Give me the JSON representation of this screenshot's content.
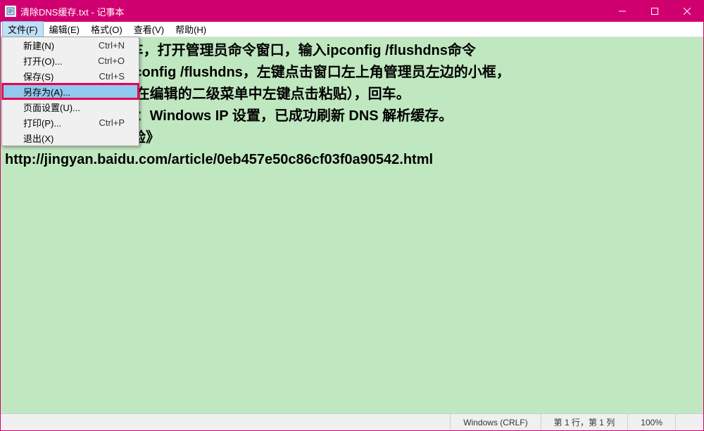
{
  "titlebar": {
    "title": "清除DNS缓存.txt - 记事本"
  },
  "menubar": {
    "items": [
      {
        "label": "文件(F)",
        "active": true
      },
      {
        "label": "编辑(E)"
      },
      {
        "label": "格式(O)"
      },
      {
        "label": "查看(V)"
      },
      {
        "label": "帮助(H)"
      }
    ]
  },
  "dropdown": {
    "items": [
      {
        "label": "新建(N)",
        "shortcut": "Ctrl+N"
      },
      {
        "label": "打开(O)...",
        "shortcut": "Ctrl+O"
      },
      {
        "label": "保存(S)",
        "shortcut": "Ctrl+S"
      },
      {
        "label": "另存为(A)...",
        "shortcut": "",
        "highlighted": true
      },
      {
        "label": "页面设置(U)...",
        "shortcut": ""
      },
      {
        "label": "打印(P)...",
        "shortcut": "Ctrl+P"
      },
      {
        "label": "退出(X)",
        "shortcut": ""
      }
    ]
  },
  "content": {
    "text": "                   MD）回车，打开管理员命令窗口，输入ipconfig /flushdns命令\n                   了复制ipconfig /flushdns，左键点击窗口左上角管理员左边的小框，\n                   击编辑，在编辑的二级菜单中左键点击粘贴），回车。\n                   就会显示：Windows IP 设置，已成功刷新 DNS 解析缓存。\n详情请参考《百度经验》\nhttp://jingyan.baidu.com/article/0eb457e50c86cf03f0a90542.html"
  },
  "statusbar": {
    "encoding": "Windows (CRLF)",
    "position": "第 1 行，第 1 列",
    "zoom": "100%"
  }
}
